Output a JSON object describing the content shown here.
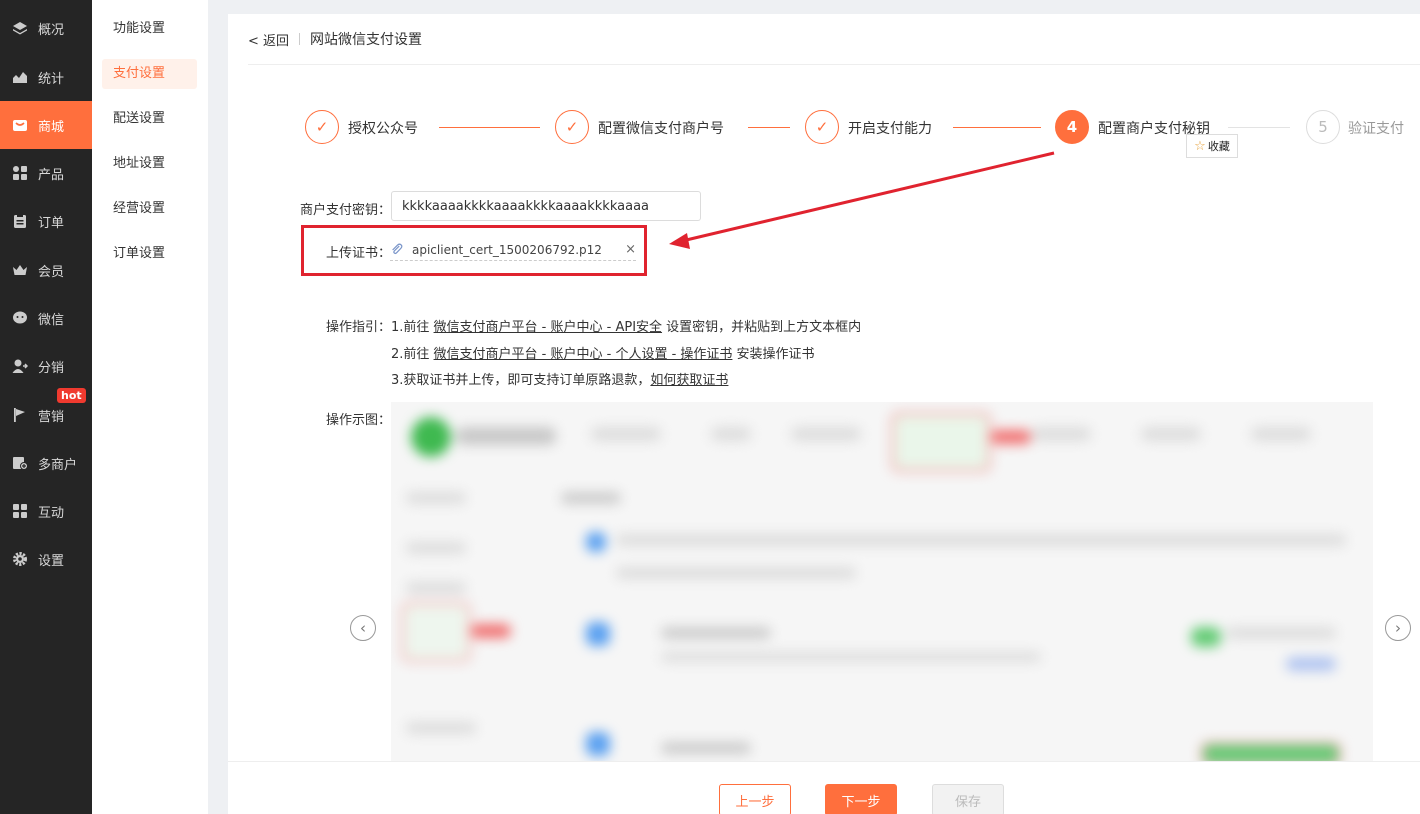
{
  "nav": {
    "items": [
      {
        "label": "概况",
        "icon": "layers-icon"
      },
      {
        "label": "统计",
        "icon": "chart-icon"
      },
      {
        "label": "商城",
        "icon": "shop-icon"
      },
      {
        "label": "产品",
        "icon": "grid-icon"
      },
      {
        "label": "订单",
        "icon": "clipboard-icon"
      },
      {
        "label": "会员",
        "icon": "crown-icon"
      },
      {
        "label": "微信",
        "icon": "wechat-icon"
      },
      {
        "label": "分销",
        "icon": "user-share-icon"
      },
      {
        "label": "营销",
        "icon": "flag-icon"
      },
      {
        "label": "多商户",
        "icon": "store-plus-icon"
      },
      {
        "label": "互动",
        "icon": "apps-icon"
      },
      {
        "label": "设置",
        "icon": "gear-icon"
      }
    ],
    "hot_badge": "hot",
    "active_color": "#ff6f3d"
  },
  "subnav": {
    "items": [
      "功能设置",
      "支付设置",
      "配送设置",
      "地址设置",
      "经营设置",
      "订单设置"
    ]
  },
  "header": {
    "back": "< 返回",
    "title": "网站微信支付设置"
  },
  "steps": [
    {
      "label": "授权公众号",
      "marker": "✓",
      "state": "done"
    },
    {
      "label": "配置微信支付商户号",
      "marker": "✓",
      "state": "done"
    },
    {
      "label": "开启支付能力",
      "marker": "✓",
      "state": "done"
    },
    {
      "label": "配置商户支付秘钥",
      "marker": "4",
      "state": "current"
    },
    {
      "label": "验证支付",
      "marker": "5",
      "state": "todo"
    }
  ],
  "favorite": {
    "label": "收藏"
  },
  "form": {
    "key_label": "商户支付密钥：",
    "key_value": "kkkkaaaakkkkaaaakkkkaaaakkkkaaaa",
    "cert_label": "上传证书：",
    "cert_file": "apiclient_cert_1500206792.p12",
    "cert_remove": "×"
  },
  "guide": {
    "label": "操作指引：",
    "line1_prefix": "1.前往 ",
    "line1_link": "微信支付商户平台 - 账户中心 - API安全",
    "line1_suffix": " 设置密钥，并粘贴到上方文本框内",
    "line2_prefix": "2.前往 ",
    "line2_link": "微信支付商户平台 - 账户中心 - 个人设置 - 操作证书",
    "line2_suffix": " 安装操作证书",
    "line3_prefix": "3.获取证书并上传，即可支持订单原路退款，",
    "line3_link": "如何获取证书"
  },
  "preview": {
    "label": "操作示图：",
    "prev": "‹",
    "next": "›"
  },
  "footer": {
    "prev": "上一步",
    "next": "下一步",
    "save": "保存"
  },
  "colors": {
    "accent": "#ff6f3d",
    "annotation": "#e0232f"
  }
}
